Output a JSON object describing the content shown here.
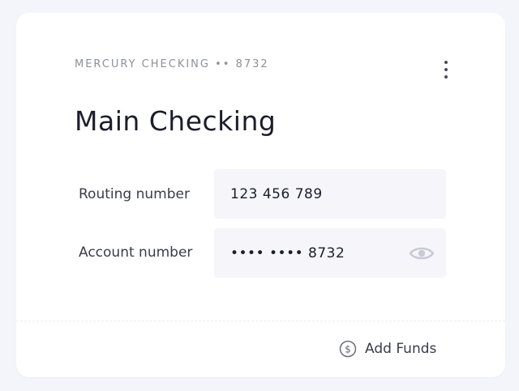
{
  "account": {
    "eyebrow": "MERCURY CHECKING •• 8732",
    "name": "Main Checking"
  },
  "details": {
    "routing": {
      "label": "Routing number",
      "value": "123 456 789"
    },
    "account": {
      "label": "Account number",
      "value": "•••• •••• 8732"
    }
  },
  "actions": {
    "add_funds_label": "Add Funds",
    "more_icon": "vertical-ellipsis-icon",
    "reveal_icon": "eye-icon",
    "funds_icon": "dollar-circle-icon"
  },
  "colors": {
    "background": "#f4f5fa",
    "card": "#ffffff",
    "field": "#f5f5fa",
    "muted_text": "#8e909c",
    "primary_text": "#1b1d2b",
    "eye_icon": "#c9cad6"
  }
}
